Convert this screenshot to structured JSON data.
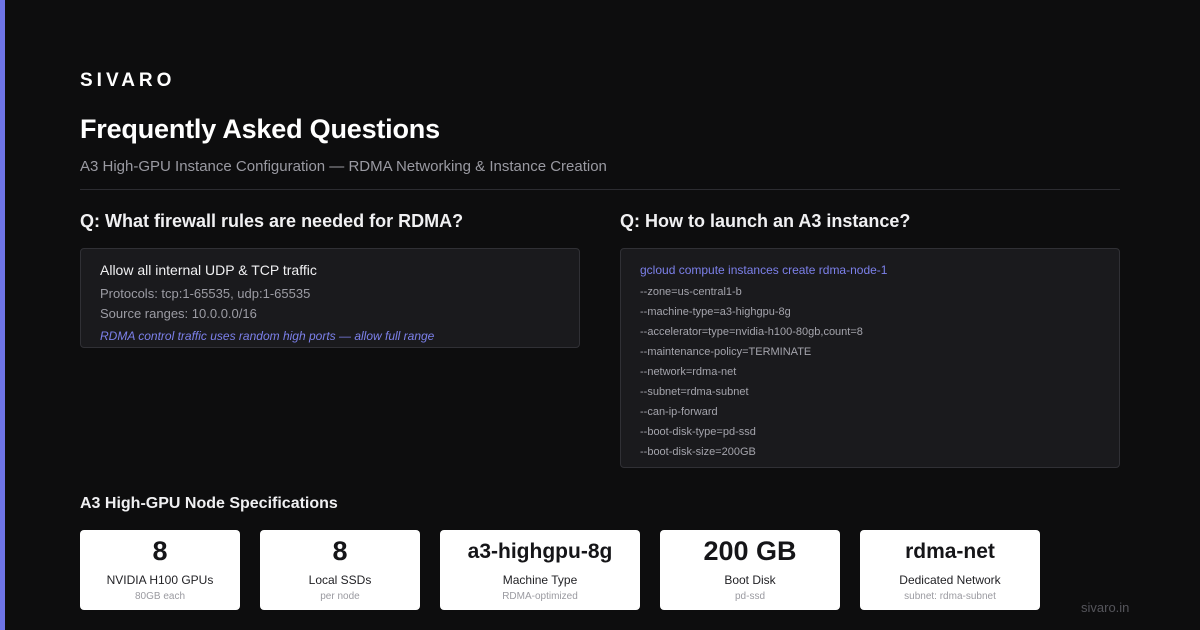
{
  "brand": "SIVARO",
  "title": "Frequently Asked Questions",
  "subtitle": "A3 High-GPU Instance Configuration — RDMA Networking & Instance Creation",
  "faq_left": {
    "question": "Q: What firewall rules are needed for RDMA?",
    "heading": "Allow all internal UDP & TCP traffic",
    "protocols": "Protocols: tcp:1-65535, udp:1-65535",
    "source_ranges": "Source ranges: 10.0.0.0/16",
    "note": "RDMA control traffic uses random high ports — allow full range"
  },
  "faq_right": {
    "question": "Q: How to launch an A3 instance?",
    "command": "gcloud compute instances create rdma-node-1",
    "flags": [
      "--zone=us-central1-b",
      "--machine-type=a3-highgpu-8g",
      "--accelerator=type=nvidia-h100-80gb,count=8",
      "--maintenance-policy=TERMINATE",
      "--network=rdma-net",
      "--subnet=rdma-subnet",
      "--can-ip-forward",
      "--boot-disk-type=pd-ssd",
      "--boot-disk-size=200GB"
    ]
  },
  "specs": {
    "heading": "A3 High-GPU Node Specifications",
    "items": [
      {
        "value": "8",
        "label": "NVIDIA H100 GPUs",
        "sub": "80GB each"
      },
      {
        "value": "8",
        "label": "Local SSDs",
        "sub": "per node"
      },
      {
        "value": "a3-highgpu-8g",
        "label": "Machine Type",
        "sub": "RDMA-optimized"
      },
      {
        "value": "200 GB",
        "label": "Boot Disk",
        "sub": "pd-ssd"
      },
      {
        "value": "rdma-net",
        "label": "Dedicated Network",
        "sub": "subnet: rdma-subnet"
      }
    ]
  },
  "footer_url": "sivaro.in",
  "colors": {
    "accent": "#6e74e6",
    "background": "#0d0d0e",
    "card": "#1a1a1d",
    "link_text": "#7c80ea"
  }
}
